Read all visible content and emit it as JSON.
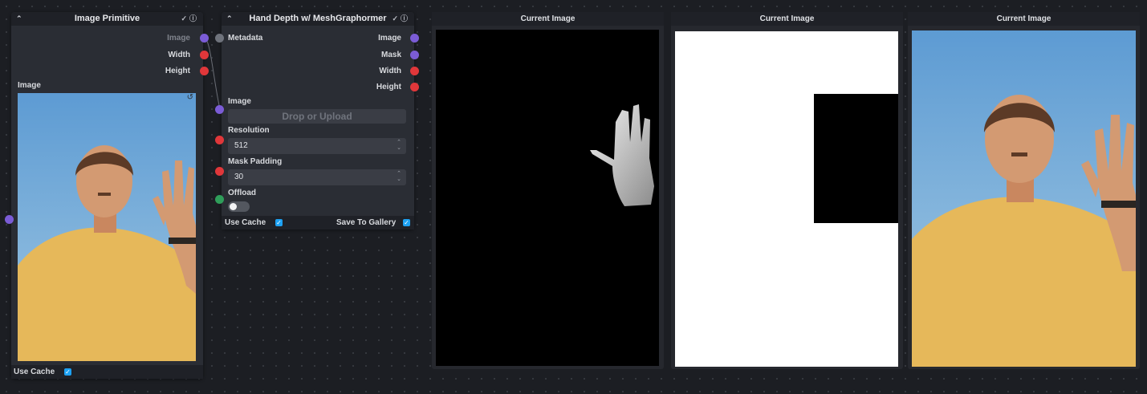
{
  "nodes": {
    "image_primitive": {
      "title": "Image Primitive",
      "outputs": [
        "Image",
        "Width",
        "Height"
      ],
      "image_label": "Image",
      "use_cache_label": "Use Cache"
    },
    "hand_depth": {
      "title": "Hand Depth w/ MeshGraphormer",
      "input_metadata": "Metadata",
      "outputs": [
        "Image",
        "Mask",
        "Width",
        "Height"
      ],
      "image_label": "Image",
      "upload_placeholder": "Drop or Upload",
      "resolution_label": "Resolution",
      "resolution_value": "512",
      "mask_padding_label": "Mask Padding",
      "mask_padding_value": "30",
      "offload_label": "Offload",
      "use_cache_label": "Use Cache",
      "save_to_gallery_label": "Save To Gallery"
    },
    "preview_1": {
      "title": "Current Image"
    },
    "preview_2": {
      "title": "Current Image"
    },
    "preview_3": {
      "title": "Current Image"
    }
  },
  "icons": {
    "collapse": "chevron-up-icon",
    "check": "check-icon",
    "info": "info-icon",
    "reset": "reset-icon"
  },
  "colors": {
    "image_socket": "#7b5cd6",
    "int_socket": "#e0373a",
    "metadata_socket": "#6f737c",
    "bool_socket": "#2f9e5a",
    "checkbox": "#1da1f2"
  }
}
